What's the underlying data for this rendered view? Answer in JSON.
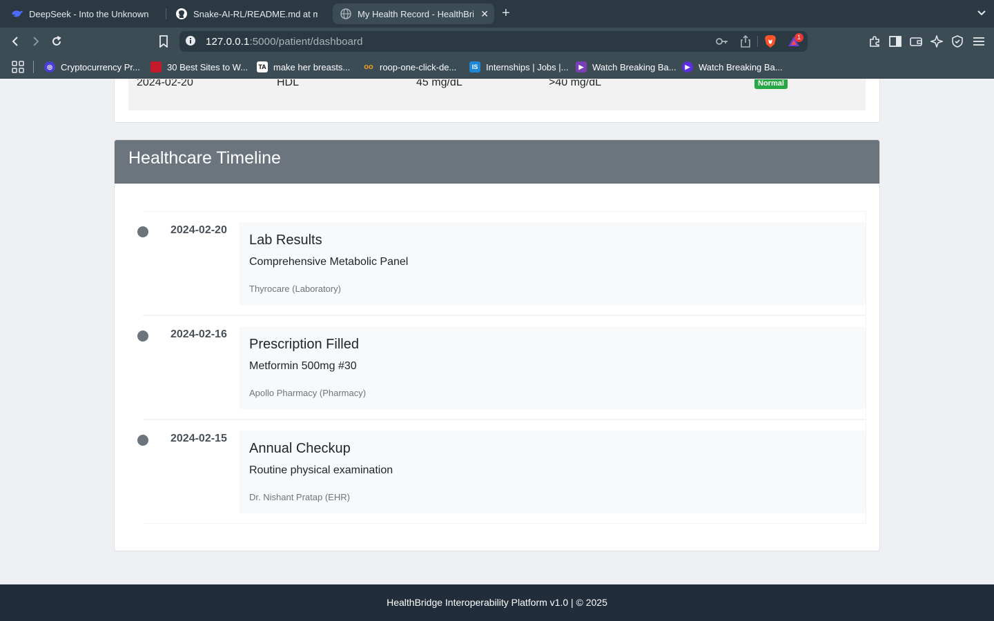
{
  "browser": {
    "tabs": [
      {
        "title": "DeepSeek - Into the Unknown",
        "icon": "deepseek-whale-icon"
      },
      {
        "title": "Snake-AI-RL/README.md at main",
        "icon": "github-icon"
      },
      {
        "title": "My Health Record - HealthBridge",
        "icon": "globe-icon",
        "active": true
      }
    ],
    "new_tab": "+",
    "url_host": "127.0.0.1",
    "url_rest": ":5000/patient/dashboard",
    "shields_count": "1",
    "bookmarks": [
      {
        "label": "Cryptocurrency Pr...",
        "color": "#4a3fd6",
        "glyph": "◎"
      },
      {
        "label": "30 Best Sites to W...",
        "color": "#c41a2c",
        "glyph": ""
      },
      {
        "label": "make her breasts...",
        "color": "#ffffff",
        "glyph": "TA"
      },
      {
        "label": "roop-one-click-de...",
        "color": "#f0a01e",
        "glyph": "oo"
      },
      {
        "label": "Internships | Jobs |...",
        "color": "#1e88d6",
        "glyph": "IS"
      },
      {
        "label": "Watch Breaking Ba...",
        "color": "#7b3fb5",
        "glyph": "▶"
      },
      {
        "label": "Watch Breaking Ba...",
        "color": "#5b2ee0",
        "glyph": "▶"
      }
    ]
  },
  "lab_row": {
    "date": "2024-02-20",
    "test": "HDL",
    "value": "45 mg/dL",
    "reference": ">40 mg/dL",
    "status": "Normal"
  },
  "timeline": {
    "title": "Healthcare Timeline",
    "events": [
      {
        "date": "2024-02-20",
        "title": "Lab Results",
        "description": "Comprehensive Metabolic Panel",
        "source": "Thyrocare (Laboratory)"
      },
      {
        "date": "2024-02-16",
        "title": "Prescription Filled",
        "description": "Metformin 500mg #30",
        "source": "Apollo Pharmacy (Pharmacy)"
      },
      {
        "date": "2024-02-15",
        "title": "Annual Checkup",
        "description": "Routine physical examination",
        "source": "Dr. Nishant Pratap (EHR)"
      }
    ]
  },
  "footer": {
    "text": "HealthBridge Interoperability Platform v1.0 | © 2025"
  },
  "colors": {
    "accent": "#6c757d",
    "status_normal": "#28a745",
    "footer_bg": "#222d3b",
    "chrome_bg": "#3c4c55"
  }
}
